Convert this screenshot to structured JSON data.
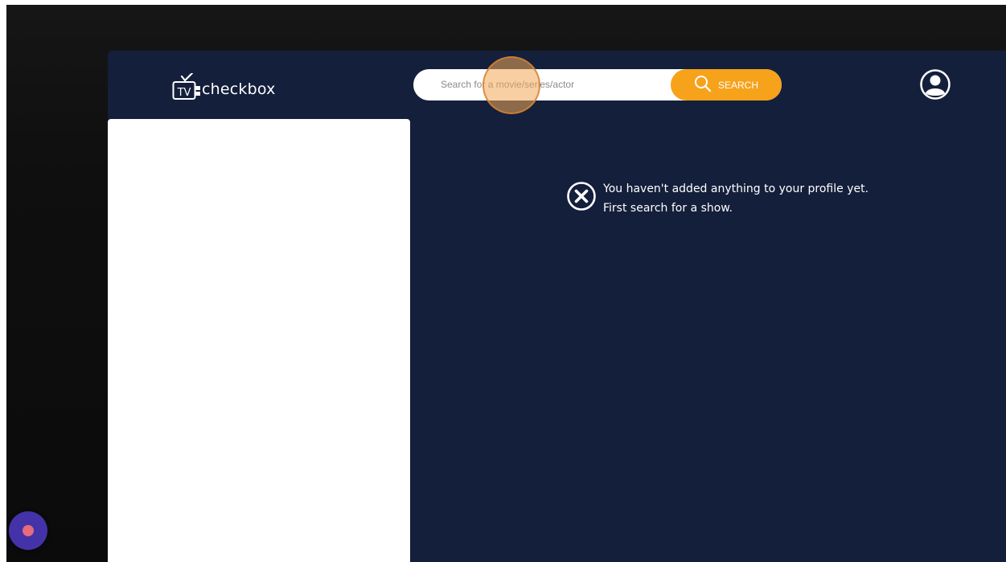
{
  "header": {
    "logo_badge": "TV",
    "logo_text": "checkbox",
    "search": {
      "placeholder": "Search for a movie/series/actor",
      "value": "",
      "button_label": "SEARCH",
      "icon": "search-icon"
    },
    "profile_icon": "user-circle-icon"
  },
  "main": {
    "empty_state": {
      "icon": "close-circle-icon",
      "line1": "You haven't added anything to your profile yet.",
      "line2": "First search for a show."
    }
  },
  "colors": {
    "app_background": "#141f3b",
    "accent": "#f7a21b",
    "widget": "#4433a8",
    "widget_dot": "#e56b7d"
  }
}
